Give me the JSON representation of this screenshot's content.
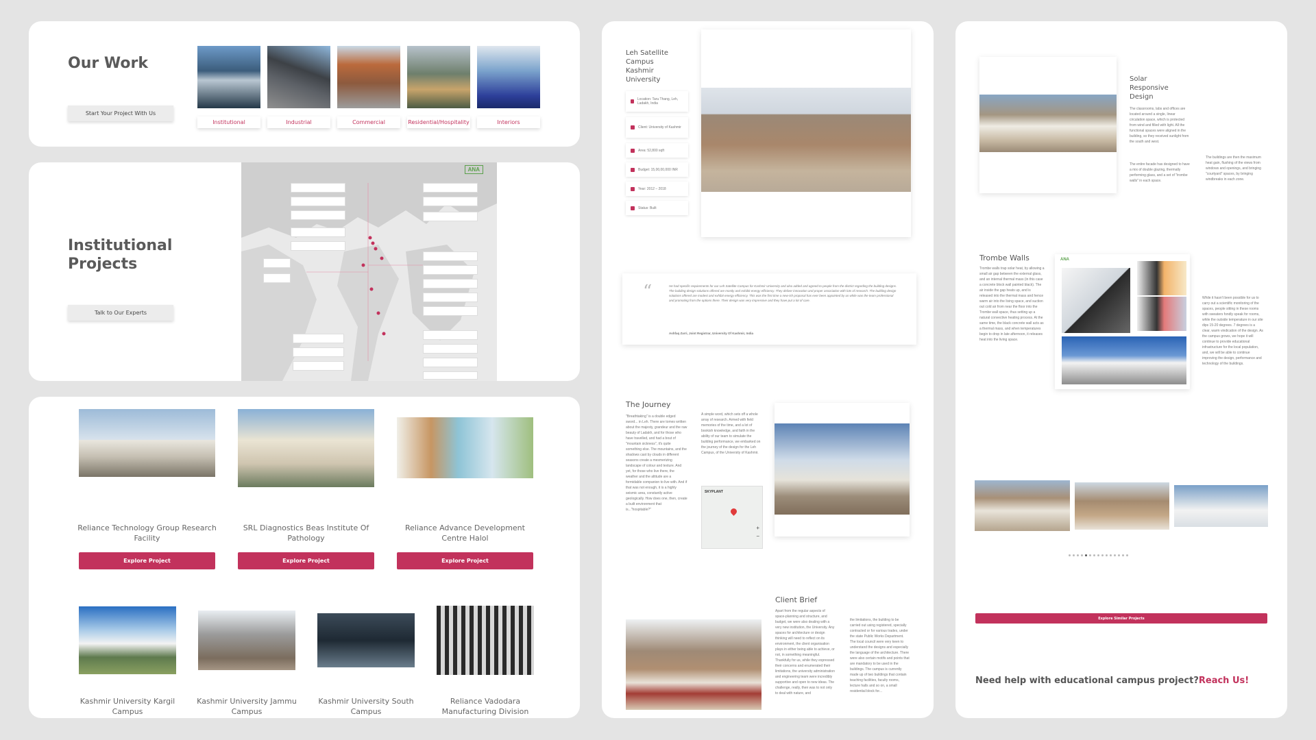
{
  "panel1": {
    "title": "Our Work",
    "cta": "Start Your Project With Us",
    "categories": [
      "Institutional",
      "Industrial",
      "Commercial",
      "Residential/Hospitality",
      "Interiors"
    ]
  },
  "panel2": {
    "title": "Institutional Projects",
    "cta": "Talk to Our Experts",
    "map_logo": "ANA"
  },
  "panel3": {
    "explore_label": "Explore Project",
    "projects_row1": [
      "Reliance Technology Group Research Facility",
      "SRL Diagnostics Beas Institute Of Pathology",
      "Reliance Advance Development Centre Halol"
    ],
    "projects_row2": [
      "Kashmir University Kargil Campus",
      "Kashmir University Jammu Campus",
      "Kashmir University South Campus",
      "Reliance Vadodara Manufacturing Division"
    ]
  },
  "panel4": {
    "title": "Leh Satellite Campus Kashmir University",
    "info": [
      "Location: Taru Thang, Leh, Ladakh, India",
      "Client: University of Kashmir",
      "Area: 52,800 sqft",
      "Budget: 15,00,00,000 INR",
      "Year: 2012 – 2018",
      "Status: Built"
    ],
    "quote": "He had specific requirements for our Leh Satellite Campus for Kashmir University and also added and agreed to people from the district regarding the building designs. The building design solutions offered are mostly and exhibit energy efficiency. They deliver innovation and proper association with lots of research. The building design solutions offered are modest and exhibit energy efficiency. This was the first time a new-ish proposal has ever been appointed by us while was the team professional and promoting from the options there. Their design was very impressive and they have put a lot of care.",
    "quote_author": "Ashfaq Zarri, Joint Registrar, University Of Kashmir, India",
    "journey_title": "The Journey",
    "journey_text1": "\"Breathtaking\" is a double edged sword... in Leh. There are tomes written about the majesty, grandeur and the raw beauty of Ladakh, and for those who have travelled, and had a bout of \"mountain sickness\", it's quite something else. The mountains, and the shadows cast by clouds in different seasons create a mesmerizing landscape of colour and texture. And yet, for those who live there, the weather and the altitude are a formidable companion to live with. And if that was not enough, it is a highly seismic area, constantly active geologically. How does one, then, create a built environment that is...\"hospitable?\"",
    "journey_text2": "A simple word, which sets off a whole array of research. Armed with field memories of the time, and a lot of bookish knowledge, and faith in the ability of our team to simulate the building performance, we embarked on the journey of the design for the Leh Campus, of the University of Kashmir.",
    "map_place": "SKYPLANT",
    "client_title": "Client Brief",
    "client_text1": "Apart from the regular aspects of space-planning and structure, and budget, we were also dealing with a very new institution, the University. Any spaces for architecture or design thinking will need to reflect on its environment, the client organisation plays in either being able to achieve, or not, in something meaningful. Thankfully for us, while they expressed their concerns and enumerated their limitations, the university administration and engineering team were incredibly supportive and open to new ideas. The challenge, really, then was to not only to deal with nature, and",
    "client_text2": "the limitations, the building to be carried out using registered, specially contracted or for various trades, under the state Public Works Department. The local council were very keen to understand the designs and especially the language of the architecture. There were also certain motifs and points that are mandatory to be used in the buildings. The campus is currently made up of two buildings that contain teaching facilities, faculty rooms, lecture halls and so on, a small residential block for..."
  },
  "panel5": {
    "solar_title": "Solar Responsive Design",
    "solar_text1": "The classrooms, labs and offices are located around a single, linear circulation space, which is protected from wind and filled with light. All the functional spaces were aligned in the building, so they received sunlight from the south and west.",
    "solar_text2": "The entire facade has designed to have a mix of double glazing, thermally performing glass, and a set of \"trombe walls\" in each space.",
    "solar_text3": "The buildings are then the maximum heat gain, flushing of the views from windows and openings, and bringing \"courtyard\" spaces, by bringing windbreaks in each zone.",
    "trombe_title": "Trombe Walls",
    "trombe_text": "Trombe walls trap solar heat, by allowing a small air gap between the external glass, and an internal thermal mass (in this case a concrete block wall painted black). The air inside the gap heats up, and is released into the thermal mass and hence warm air into the living space, and suction out cold air from near the floor into the Trombe wall space, thus setting up a natural convective heating process. At the same time, the black concrete wall acts as a thermal mass, and when temperatures begin to drop in late afternoon, it releases heat into the living space.",
    "trombe_text2": "While it hasn't been possible for us to carry out a scientific monitoring of the spaces, people sitting in these rooms with sweaters fondly speak for rooms, while the outside temperature in our site dips 15-20 degrees. 7 degrees is a clear, warm vindication of the design. As the campus grows, we hope it will continue to provide educational infrastructure for the local population, and, we will be able to continue improving the design, performance and technology of the buildings.",
    "logo": "ANA",
    "explore_similar": "Explore Similar Projects",
    "help_text": "Need help with educational campus project?",
    "help_link": "Reach Us!"
  },
  "colors": {
    "accent": "#c2325c",
    "background": "#e4e4e4",
    "panel": "#ffffff"
  }
}
